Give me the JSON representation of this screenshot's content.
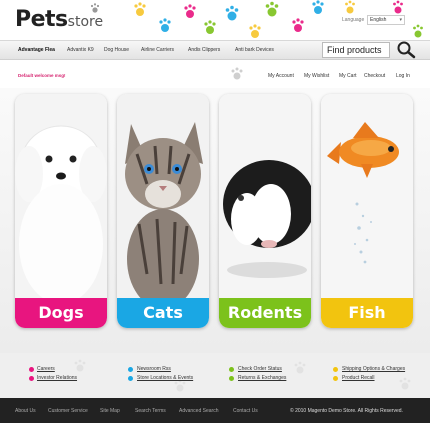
{
  "logo": {
    "main": "Pets",
    "sub": "store"
  },
  "language": {
    "label": "Language",
    "selected": "English"
  },
  "nav": {
    "items": [
      "Advantage Flea",
      "Advantix K9",
      "Dog House",
      "Airline Carriers",
      "Andis Clippers",
      "Anti bark Devices"
    ]
  },
  "search": {
    "placeholder": "Find products"
  },
  "welcome": "Default welcome msg!",
  "account_links": [
    "My Account",
    "My Wishlist",
    "My Cart",
    "Checkout",
    "Log In"
  ],
  "categories": [
    {
      "label": "Dogs",
      "color": "#e8157f"
    },
    {
      "label": "Cats",
      "color": "#1aa7e4"
    },
    {
      "label": "Rodents",
      "color": "#7cc21b"
    },
    {
      "label": "Fish",
      "color": "#f2c40f"
    }
  ],
  "footer_links": {
    "col1": [
      "Careers",
      "Investor Relations"
    ],
    "col2": [
      "Newsroom Rss",
      "Store Locations & Events"
    ],
    "col3": [
      "Check Order Status",
      "Returns & Exchanges"
    ],
    "col4": [
      "Shipping Options & Charges",
      "Product Recall"
    ]
  },
  "bottom_links": [
    "About Us",
    "Customer Service",
    "Site Map",
    "Search Terms",
    "Advanced Search",
    "Contact Us"
  ],
  "copyright": "© 2010 Magento Demo Store. All Rights Reserved."
}
